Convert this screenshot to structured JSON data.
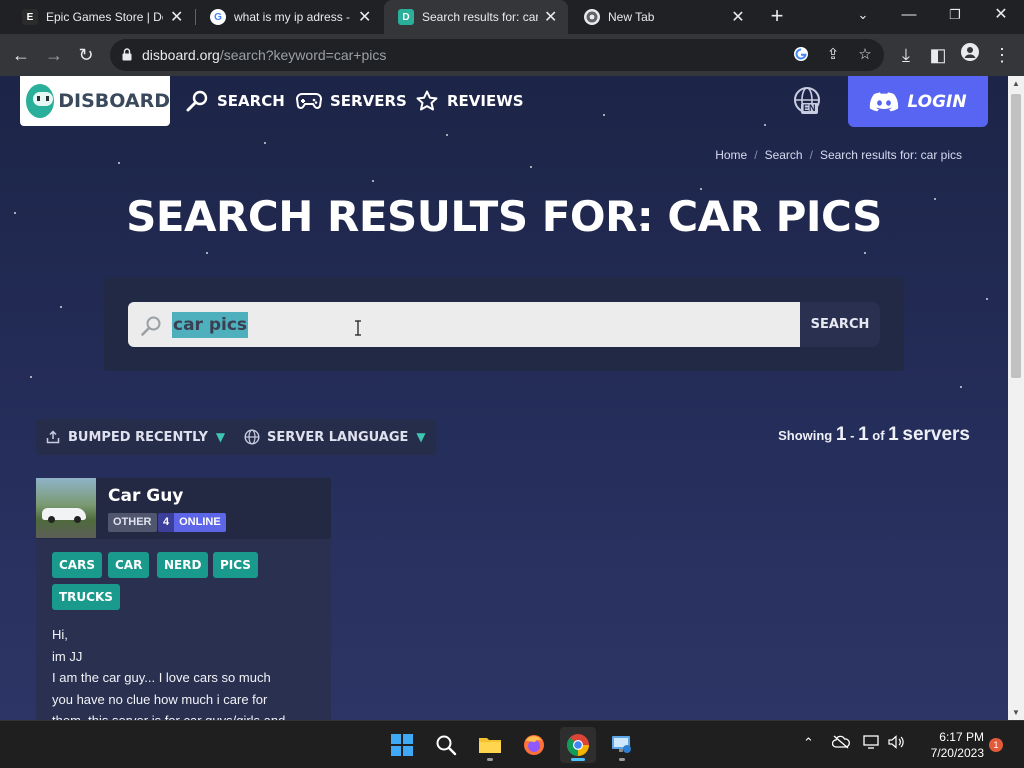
{
  "browser": {
    "tabs": [
      {
        "title": "Epic Games Store | Dov",
        "favicon": "epic-icon"
      },
      {
        "title": "what is my ip adress - G",
        "favicon": "google-icon"
      },
      {
        "title": "Search results for: car p",
        "favicon": "disboard-icon",
        "active": true
      },
      {
        "title": "New Tab",
        "favicon": "chrome-icon"
      }
    ],
    "url_host": "disboard.org",
    "url_path": "/search?keyword=car+pics"
  },
  "site": {
    "logo_text": "DISBOARD",
    "nav": [
      {
        "label": "SEARCH",
        "icon": "search-icon"
      },
      {
        "label": "SERVERS",
        "icon": "gamepad-icon"
      },
      {
        "label": "REVIEWS",
        "icon": "star-icon"
      }
    ],
    "language_code": "EN",
    "login_label": "LOGIN",
    "accent_color": "#5865f2",
    "tag_color": "#1a9a8c"
  },
  "breadcrumb": {
    "home": "Home",
    "search": "Search",
    "current": "Search results for: car pics"
  },
  "page_title": "SEARCH RESULTS FOR: CAR PICS",
  "search": {
    "value": "car pics",
    "button_label": "SEARCH"
  },
  "filters": {
    "sort_label": "BUMPED RECENTLY",
    "language_label": "SERVER LANGUAGE"
  },
  "results": {
    "showing_word": "Showing",
    "from": "1",
    "dash": "-",
    "to": "1",
    "of_word": "of",
    "total": "1",
    "unit": "servers"
  },
  "server": {
    "name": "Car Guy",
    "category": "OTHER",
    "online_count": "4",
    "online_label": "ONLINE",
    "tags": [
      "CARS",
      "CAR",
      "NERD",
      "PICS",
      "TRUCKS"
    ],
    "description_lines": [
      "Hi,",
      "im JJ",
      "I am the car guy... I love cars so much",
      "you have no clue how much i care for",
      "them. this server is for car guys/girls and"
    ]
  },
  "taskbar": {
    "time": "6:17 PM",
    "date": "7/20/2023",
    "notification_count": "1"
  }
}
